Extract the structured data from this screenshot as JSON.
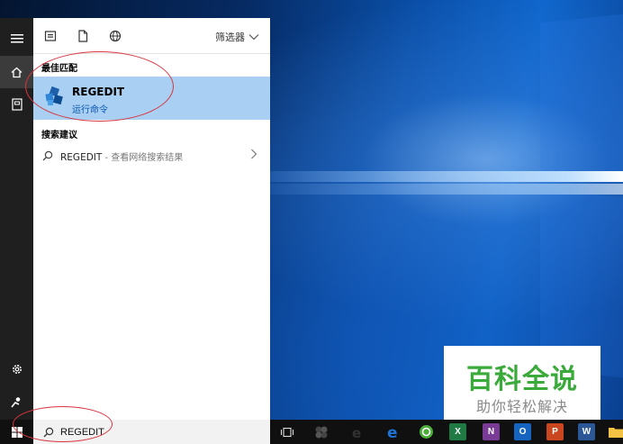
{
  "start_menu": {
    "filter_label": "筛选器",
    "best_match": {
      "heading": "最佳匹配",
      "title": "REGEDIT",
      "subtitle": "运行命令"
    },
    "suggestions": {
      "heading": "搜索建议",
      "items": [
        {
          "term": "REGEDIT",
          "hint": " - 查看网络搜索结果"
        }
      ]
    }
  },
  "search": {
    "value": "REGEDIT"
  },
  "taskbar_icons": [
    {
      "name": "edge",
      "color": "#1e73d4"
    },
    {
      "name": "360-browser",
      "color": "#4cae3a"
    },
    {
      "name": "excel",
      "label": "X",
      "color": "#1f7a43"
    },
    {
      "name": "onenote",
      "label": "N",
      "color": "#7a3b97"
    },
    {
      "name": "outlook",
      "label": "O",
      "color": "#1565c0"
    },
    {
      "name": "powerpoint",
      "label": "P",
      "color": "#c9461f"
    },
    {
      "name": "word",
      "label": "W",
      "color": "#2b5797"
    }
  ],
  "watermark": {
    "main": "百科全说",
    "sub": "助你轻松解决"
  },
  "colors": {
    "highlight": "#a9cff2",
    "annotation": "#d9363e",
    "watermark_green": "#3aaa3a"
  }
}
